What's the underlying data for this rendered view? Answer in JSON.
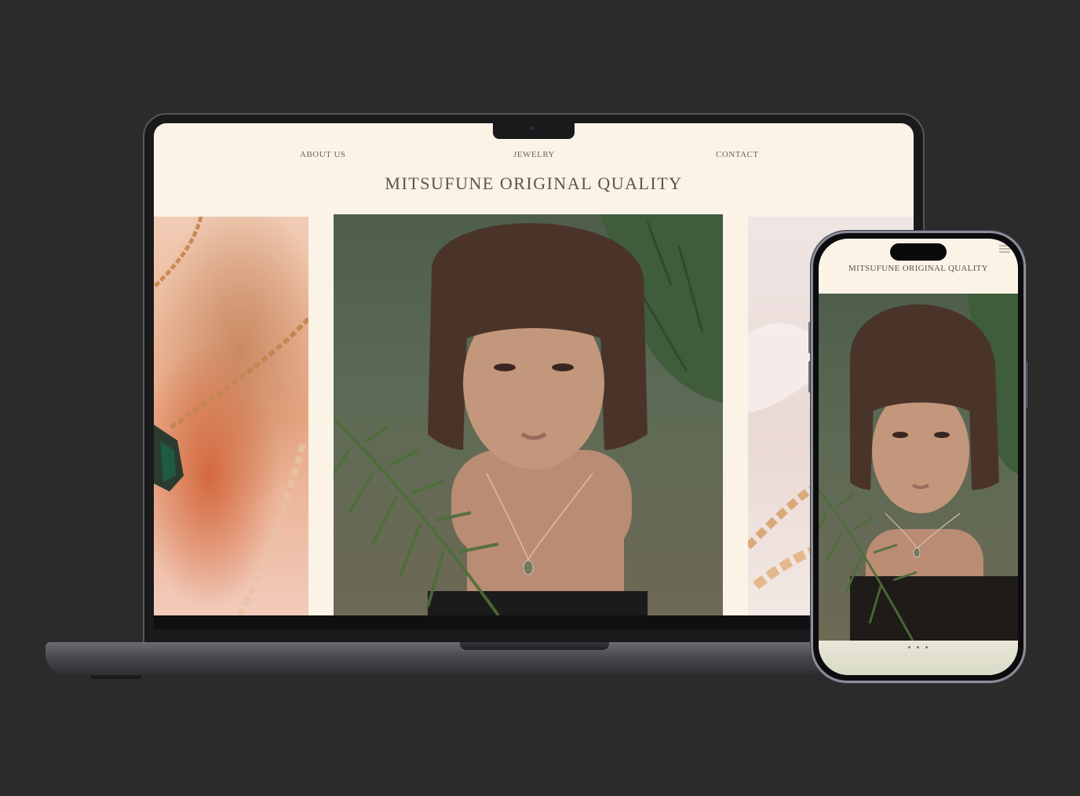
{
  "laptop": {
    "nav": {
      "about": "ABOUT US",
      "jewelry": "JEWELRY",
      "contact": "CONTACT"
    },
    "title": "MITSUFUNE ORIGINAL QUALITY"
  },
  "phone": {
    "title": "MITSUFUNE ORIGINAL QUALITY",
    "carousel_indicator": "• • •"
  },
  "icons": {
    "menu": "hamburger-menu-icon",
    "camera": "camera-icon"
  },
  "colors": {
    "page_background": "#2b2b2b",
    "site_background": "#faf3e6",
    "text": "#5b544b",
    "photo_green": "#4e5e4a"
  }
}
